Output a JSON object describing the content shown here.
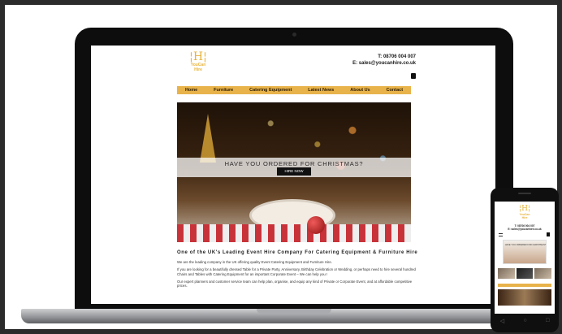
{
  "site": {
    "logo_mark": "¦H¦",
    "logo_line1": "YouCan",
    "logo_line2": "Hire",
    "phone": "T: 08706 004 007",
    "email": "E: sales@youcanhire.co.uk",
    "nav": [
      "Home",
      "Furniture",
      "Catering Equipment",
      "Latest News",
      "About Us",
      "Contact"
    ],
    "hero_title": "HAVE YOU ORDERED FOR CHRISTMAS?",
    "hero_button": "HIRE NOW",
    "heading": "One of the UK's Leading Event Hire Company For Catering Equipment & Furniture Hire",
    "para1": "We are the leading company in the UK offering quality Event Catering Equipment and Furniture Hire.",
    "para2": "If you are looking for a beautifully dressed Table for a Private Party, Anniversary, Birthday Celebration or Wedding, or perhaps need to hire several hundred Chairs and Tables with Catering Equipment for an important Corporate Event – We can help you !",
    "para3": "Our expert planners and customer service team can help plan, organise, and equip any kind of Private or Corporate Event, and at affordable competitive prices."
  },
  "phone_site": {
    "logo_mark": "¦H¦",
    "logo_line1": "YouCan",
    "logo_line2": "Hire",
    "phone": "T: 08706 004 007",
    "email": "E: sales@youcanhire.co.uk",
    "hero_title": "HAVE YOU ORDERED FOR CHRISTMAS?"
  },
  "icons": {
    "bag": "shopping-bag-icon",
    "menu": "hamburger-menu-icon",
    "phone_nav": [
      "back-icon",
      "home-icon",
      "recents-icon"
    ]
  },
  "colors": {
    "brand_gold": "#e8b34a",
    "device_black": "#0d0d0d"
  }
}
